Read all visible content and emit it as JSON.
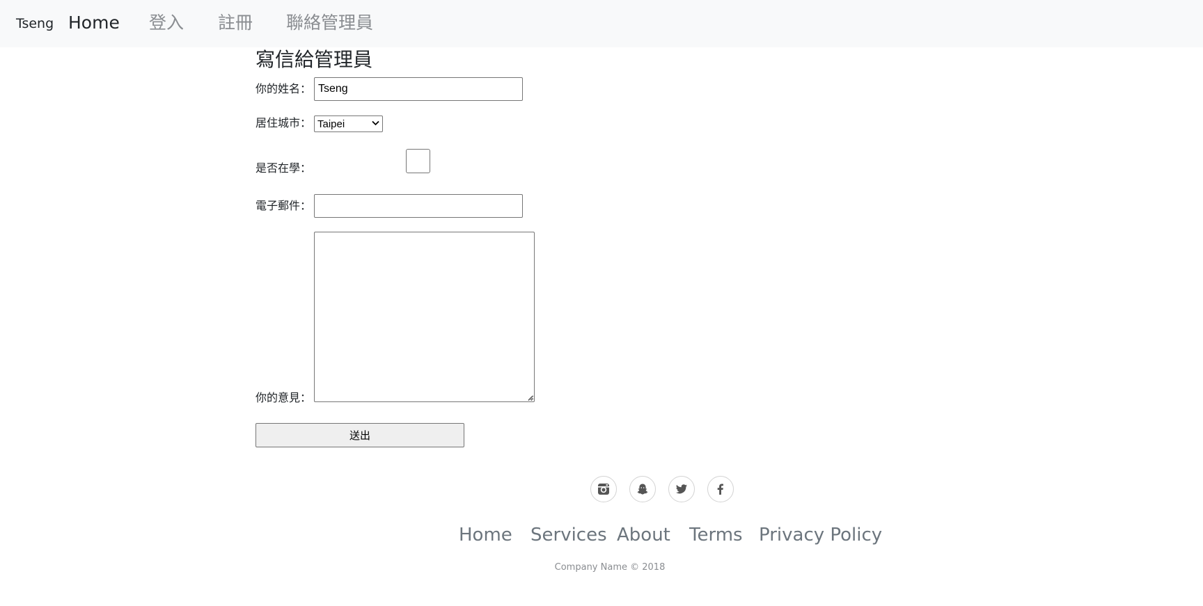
{
  "navbar": {
    "brand": "Tseng",
    "links": [
      {
        "label": "Home",
        "active": true
      },
      {
        "label": "登入",
        "active": false
      },
      {
        "label": "註冊",
        "active": false
      },
      {
        "label": "聯絡管理員",
        "active": false
      }
    ]
  },
  "form": {
    "title": "寫信給管理員",
    "name_label": "你的姓名：",
    "name_value": "Tseng",
    "city_label": "居住城市：",
    "city_selected": "Taipei",
    "student_label": "是否在學：",
    "student_checked": false,
    "email_label": "電子郵件：",
    "email_value": "",
    "opinion_label": "你的意見：",
    "opinion_value": "",
    "submit_label": "送出"
  },
  "footer": {
    "social_icons": [
      "instagram-icon",
      "snapchat-icon",
      "twitter-icon",
      "facebook-icon"
    ],
    "links": [
      "Home",
      "Services",
      "About",
      "Terms",
      "Privacy Policy"
    ],
    "copyright": "Company Name © 2018"
  },
  "colors": {
    "navbar_bg": "#f8f9fa",
    "nav_muted": "#8a8d91",
    "nav_active": "#212529",
    "footer_link": "#6c757d",
    "input_border": "#767676",
    "button_bg": "#efefef"
  }
}
